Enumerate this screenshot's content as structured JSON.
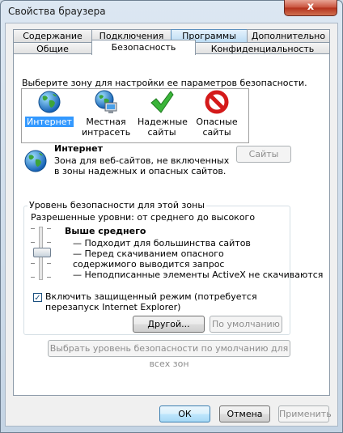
{
  "window": {
    "title": "Свойства браузера",
    "close_glyph": "x"
  },
  "tabs_row1": [
    {
      "label": "Содержание",
      "state": "normal"
    },
    {
      "label": "Подключения",
      "state": "normal"
    },
    {
      "label": "Программы",
      "state": "highlighted"
    },
    {
      "label": "Дополнительно",
      "state": "normal"
    }
  ],
  "tabs_row2": [
    {
      "label": "Общие",
      "state": "normal"
    },
    {
      "label": "Безопасность",
      "state": "active"
    },
    {
      "label": "Конфиденциальность",
      "state": "normal"
    }
  ],
  "security": {
    "zone_prompt": "Выберите зону для настройки ее параметров безопасности.",
    "zones": [
      {
        "label": "Интернет",
        "icon": "globe-icon",
        "selected": true
      },
      {
        "label": "Местная интрасеть",
        "icon": "intranet-icon",
        "selected": false
      },
      {
        "label": "Надежные сайты",
        "icon": "checkmark-icon",
        "selected": false
      },
      {
        "label": "Опасные сайты",
        "icon": "prohibited-icon",
        "selected": false
      }
    ],
    "zone_title": "Интернет",
    "zone_description": "Зона для веб-сайтов, не включенных в зоны надежных и опасных сайтов.",
    "sites_button": "Сайты",
    "level_group_title": "Уровень безопасности для этой зоны",
    "allowed_levels": "Разрешенные уровни: от среднего до высокого",
    "level_name": "Выше среднего",
    "level_bullets": [
      "— Подходит для большинства сайтов",
      "— Перед скачиванием опасного содержимого выводится запрос",
      "— Неподписанные элементы ActiveX не скачиваются"
    ],
    "protected_mode_label": "Включить защищенный режим (потребуется перезапуск Internet Explorer)",
    "protected_mode_checked": true,
    "custom_button": "Другой...",
    "default_button": "По умолчанию",
    "reset_all_button": "Выбрать уровень безопасности по умолчанию для всех зон"
  },
  "footer": {
    "ok": "ОК",
    "cancel": "Отмена",
    "apply": "Применить"
  }
}
